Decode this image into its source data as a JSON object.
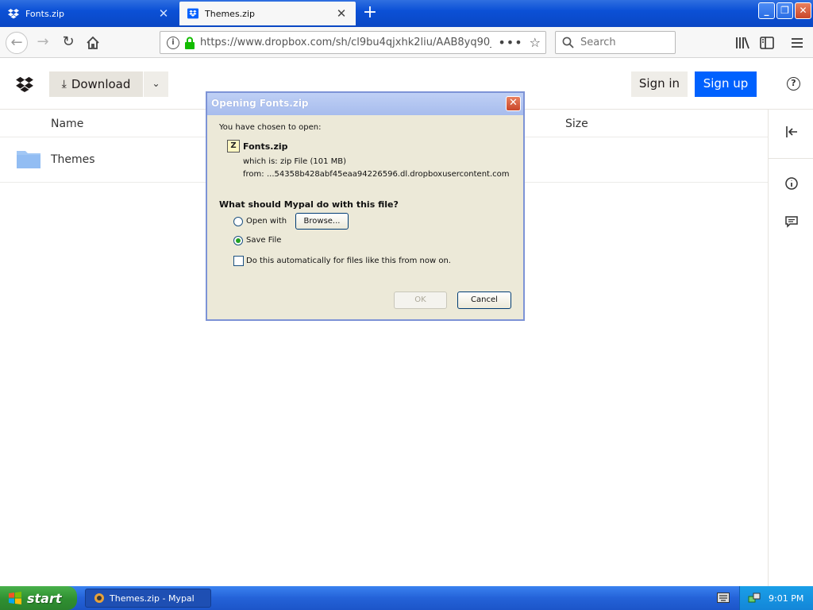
{
  "browser": {
    "tabs": [
      {
        "title": "Fonts.zip",
        "active": false
      },
      {
        "title": "Themes.zip",
        "active": true
      }
    ],
    "url": "https://www.dropbox.com/sh/cl9bu4qjxhk2liu/AAB8yq90_qB",
    "search_placeholder": "Search",
    "colors": {
      "titlebar": "#0b50d6",
      "accent": "#0061fe"
    }
  },
  "page": {
    "download_label": "Download",
    "signin_label": "Sign in",
    "signup_label": "Sign up",
    "columns": {
      "name": "Name",
      "size": "Size"
    },
    "rows": [
      {
        "name": "Themes",
        "icon": "folder-icon"
      }
    ]
  },
  "dialog": {
    "title": "Opening Fonts.zip",
    "chosen_text": "You have chosen to open:",
    "file_name": "Fonts.zip",
    "which_is_label": "which is:",
    "which_is_value": "zip File (101 MB)",
    "from_label": "from:",
    "from_value": "...54358b428abf45eaa94226596.dl.dropboxusercontent.com",
    "question": "What should Mypal do with this file?",
    "open_with_label": "Open with",
    "browse_label": "Browse...",
    "save_file_label": "Save File",
    "auto_label": "Do this automatically for files like this from now on.",
    "ok_label": "OK",
    "cancel_label": "Cancel",
    "selected_option": "save_file"
  },
  "taskbar": {
    "start_label": "start",
    "task_label": "Themes.zip - Mypal",
    "clock": "9:01 PM"
  }
}
